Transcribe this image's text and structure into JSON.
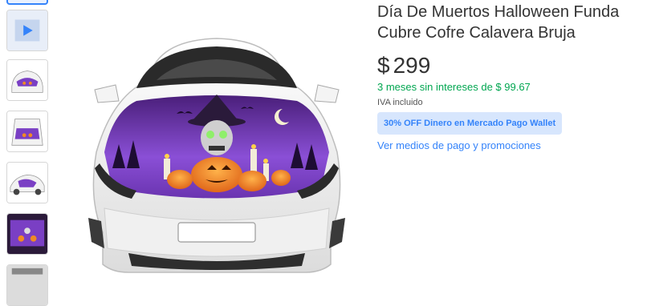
{
  "product": {
    "title": "Día De Muertos Halloween Funda\nCubre Cofre Calavera Bruja",
    "price_currency": "$",
    "price_amount": "299",
    "installments_text": "3 meses sin intereses de $ 99.67",
    "tax_note": "IVA incluido",
    "promo_badge": "30% OFF Dinero en Mercado Pago Wallet",
    "payment_link": "Ver medios de pago y promociones"
  },
  "gallery": {
    "thumbnails": [
      "video",
      "car-front",
      "car-hood",
      "car-side",
      "hood-closeup",
      "car-partial"
    ]
  },
  "colors": {
    "accent_blue": "#3483fa",
    "installments_green": "#00a650",
    "badge_bg": "#d7e6fd",
    "hood_purple": "#7a3fc4"
  }
}
